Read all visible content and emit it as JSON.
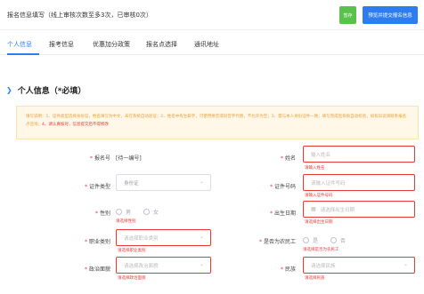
{
  "topbar": {
    "title": "报名信息填写（线上审核次数至多3次，已审核0次）",
    "save_label": "暂存",
    "preview_label": "预览并提交报名信息"
  },
  "tabs": [
    {
      "label": "个人信息",
      "active": true
    },
    {
      "label": "报考信息",
      "active": false
    },
    {
      "label": "优惠加分政策",
      "active": false
    },
    {
      "label": "报名点选择",
      "active": false
    },
    {
      "label": "通讯地址",
      "active": false
    }
  ],
  "section": {
    "title": "个人信息（*必填）"
  },
  "notice": {
    "text": "填写说明：1、证件类型选择身份证，姓名填写为中文，未在系统自动验证；2、姓名中有生僻字，可使用拼音或同音字代替，不允许为空；3、需与本人身份证件一致，填写完成后系统自动校验，如有异议请联系报名点咨询；",
    "highlight": "4、请认真核对，信息提交后不得修改"
  },
  "form": {
    "exam_id": {
      "label": "报名号",
      "value": "[待一编号]"
    },
    "name": {
      "label": "姓名",
      "placeholder": "输入姓名",
      "error": "请输入姓名"
    },
    "id_type": {
      "label": "证件类型",
      "value": "身份证"
    },
    "id_number": {
      "label": "证件号码",
      "placeholder": "请输入证件号码",
      "error": "请输入证件号码"
    },
    "gender": {
      "label": "性别",
      "options": [
        "男",
        "女"
      ],
      "error": "请选择性别"
    },
    "birth_date": {
      "label": "出生日期",
      "placeholder": "请选择出生日期",
      "error": "请选择出生日期"
    },
    "occupation": {
      "label": "职业类别",
      "placeholder": "请选择职业类别",
      "error": "请选择职业类别"
    },
    "migrant": {
      "label": "是否为农民工",
      "options": [
        "是",
        "否"
      ],
      "error": "请选择是否为农民工"
    },
    "political": {
      "label": "政治面貌",
      "placeholder": "请选择政治面貌",
      "error": "请选择政治面貌"
    },
    "ethnicity": {
      "label": "民族",
      "placeholder": "请选择民族",
      "error": "请选择民族"
    }
  },
  "colors": {
    "primary": "#2d7cf0",
    "success": "#59c24a",
    "error": "#e53935",
    "warning": "#e6a23c"
  }
}
